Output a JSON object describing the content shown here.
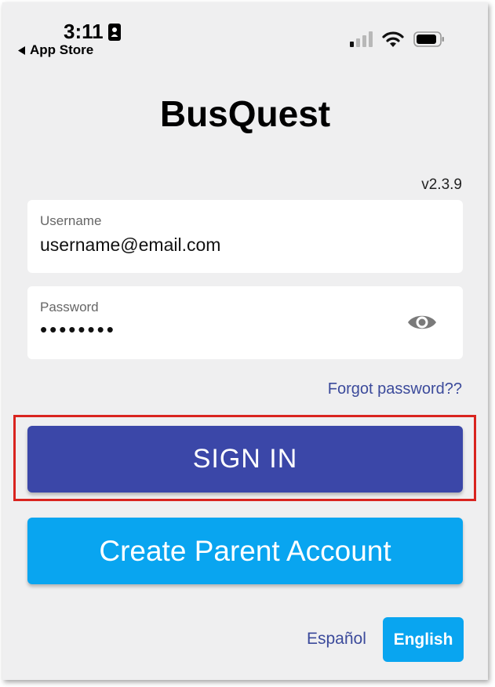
{
  "status_bar": {
    "time": "3:11",
    "back_label": "App Store",
    "icons": [
      "contact-card-icon",
      "cellular-signal-icon",
      "wifi-icon",
      "battery-icon"
    ]
  },
  "app": {
    "title": "BusQuest",
    "version": "v2.3.9"
  },
  "login_form": {
    "username": {
      "label": "Username",
      "value": "username@email.com"
    },
    "password": {
      "label": "Password",
      "value": "••••••••",
      "toggle_icon": "eye-icon"
    },
    "forgot_label": "Forgot password??"
  },
  "buttons": {
    "sign_in": "SIGN IN",
    "create_account": "Create Parent Account"
  },
  "language": {
    "spanish": "Español",
    "english": "English",
    "selected": "English"
  },
  "colors": {
    "background": "#efeff0",
    "primary": "#3b47a8",
    "accent": "#09a5f0",
    "link": "#3b4a9b",
    "highlight": "#d9241f"
  }
}
